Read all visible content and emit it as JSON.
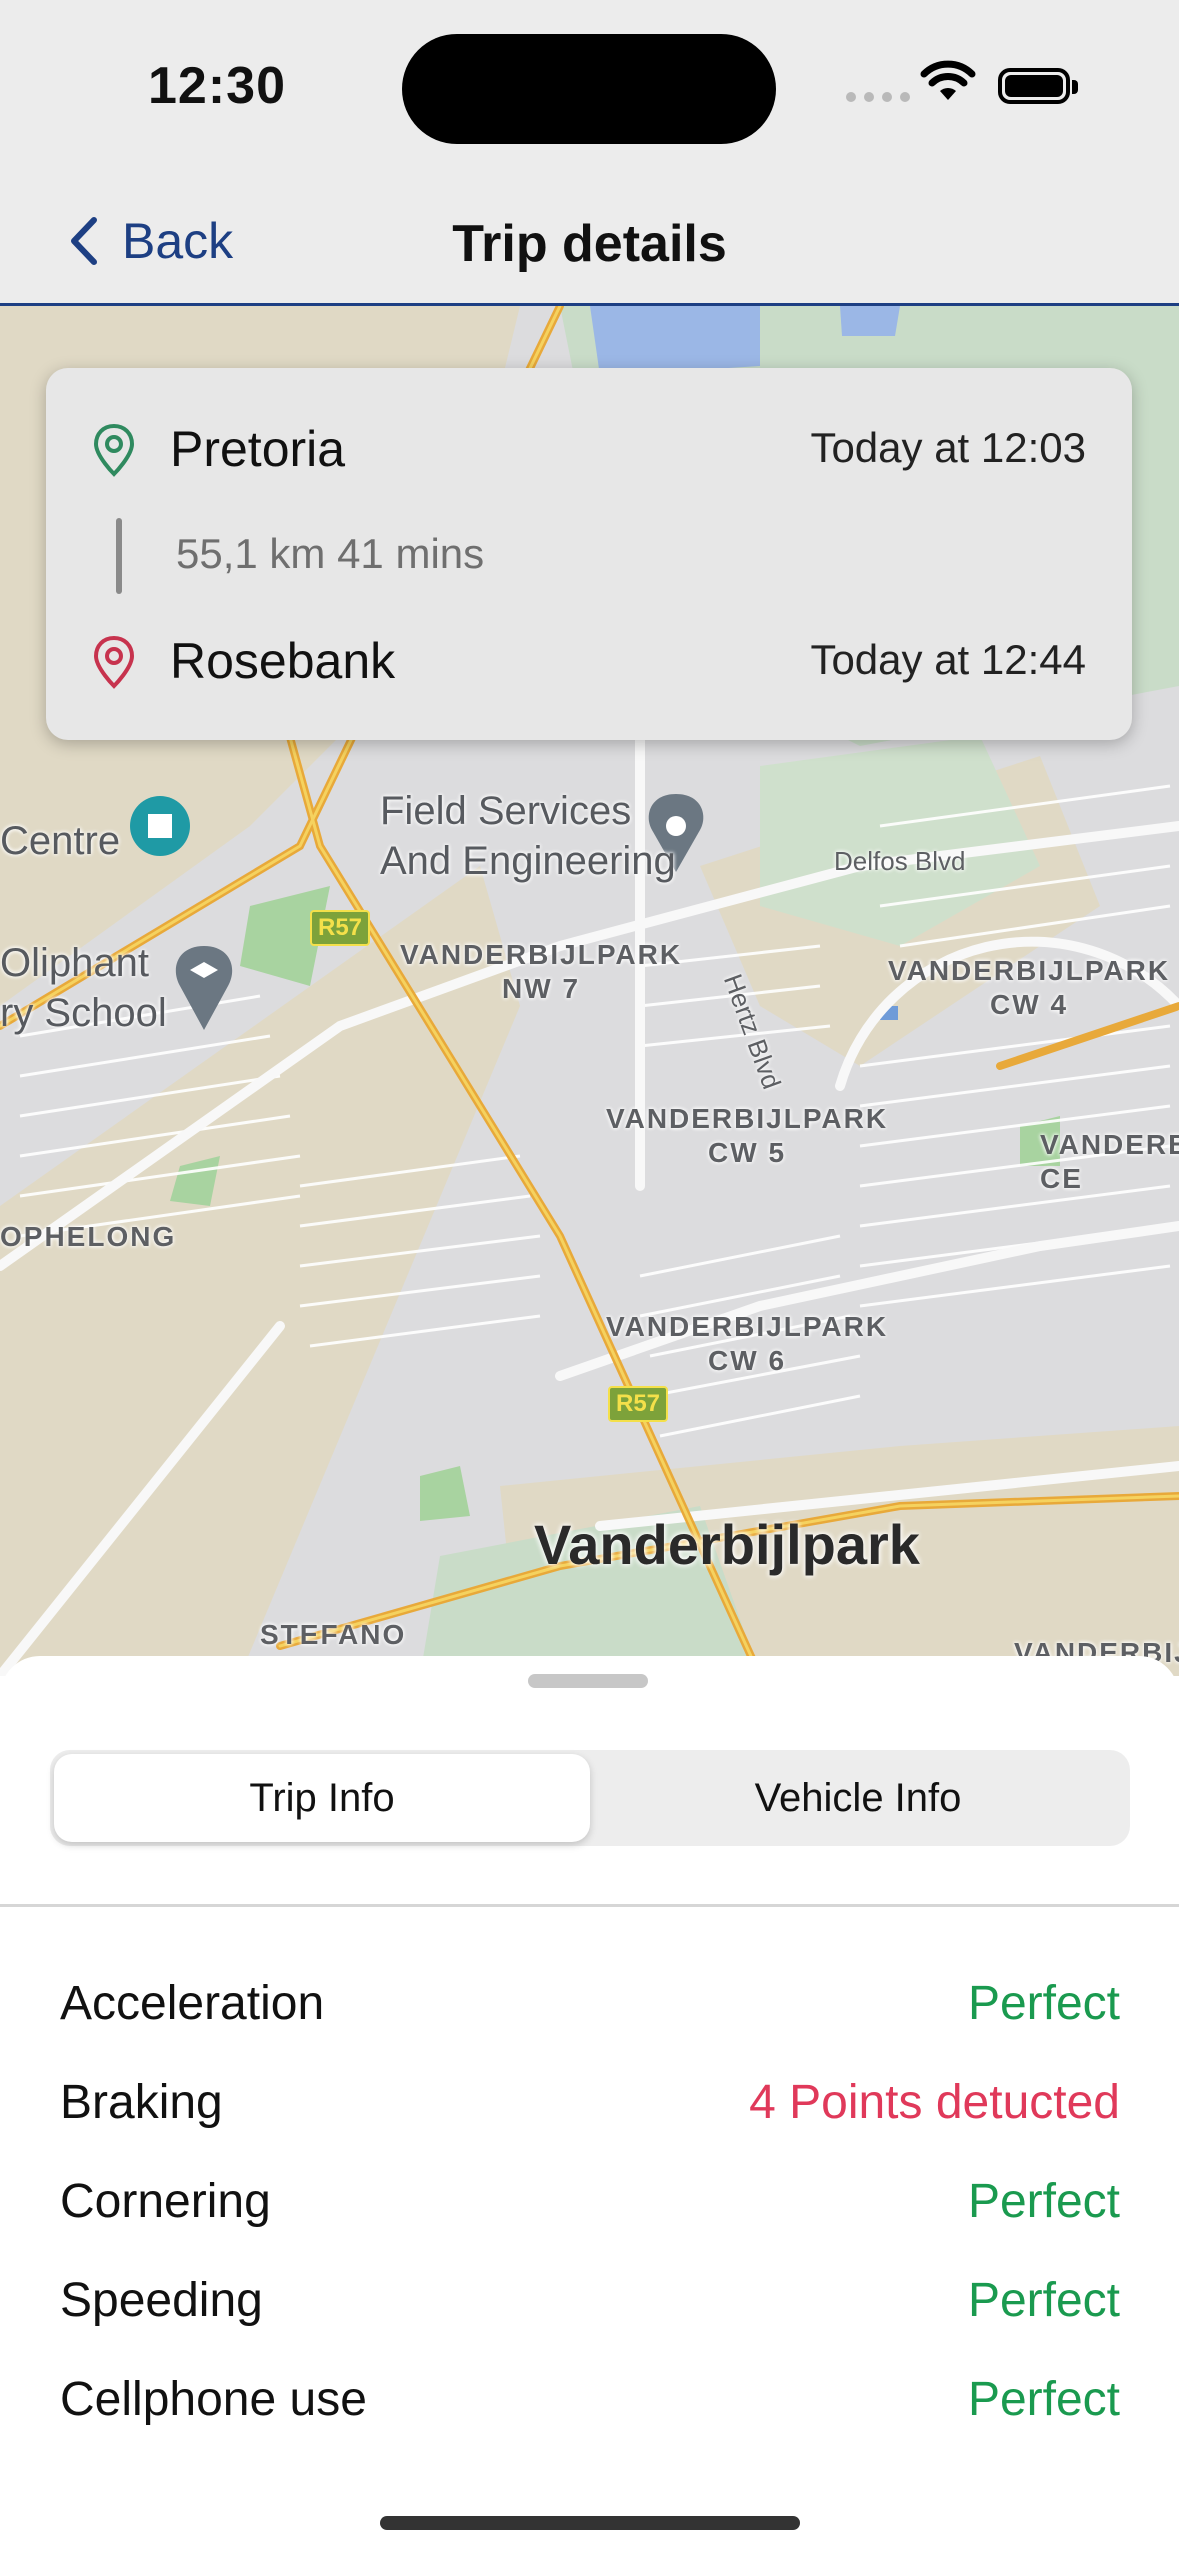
{
  "status_bar": {
    "time": "12:30"
  },
  "nav": {
    "back_label": "Back",
    "title": "Trip details"
  },
  "trip": {
    "origin": {
      "city": "Pretoria",
      "time": "Today at 12:03",
      "pin_color": "#2f8a5f"
    },
    "summary": "55,1 km 41 mins",
    "destination": {
      "city": "Rosebank",
      "time": "Today at 12:44",
      "pin_color": "#c7334e"
    }
  },
  "map": {
    "poi": {
      "field_services": "Field Services\nAnd Engineering",
      "centre": "Centre",
      "school": "Oliphant\nry School"
    },
    "areas": {
      "nw7": "VANDERBIJLPARK\nNW 7",
      "cw4": "VANDERBIJLPARK\nCW 4",
      "cw5": "VANDERBIJLPARK\nCW 5",
      "cw6": "VANDERBIJLPARK\nCW 6",
      "right_edge": "VANDERB\nCE",
      "ophelong": "OPHELONG",
      "stefano": "STEFANO",
      "bottom_right": "VANDERBIJ"
    },
    "roads": {
      "delfos": "Delfos Blvd",
      "hertz": "Hertz Blvd",
      "r57": "R57"
    },
    "city": "Vanderbijlpark"
  },
  "tabs": {
    "trip_info": "Trip Info",
    "vehicle_info": "Vehicle Info",
    "active": "trip_info"
  },
  "metrics": [
    {
      "label": "Acceleration",
      "value": "Perfect",
      "color": "#1a9a4f"
    },
    {
      "label": "Braking",
      "value": "4 Points detucted",
      "color": "#e0395a"
    },
    {
      "label": "Cornering",
      "value": "Perfect",
      "color": "#1a9a4f"
    },
    {
      "label": "Speeding",
      "value": "Perfect",
      "color": "#1a9a4f"
    },
    {
      "label": "Cellphone use",
      "value": "Perfect",
      "color": "#1a9a4f"
    }
  ]
}
